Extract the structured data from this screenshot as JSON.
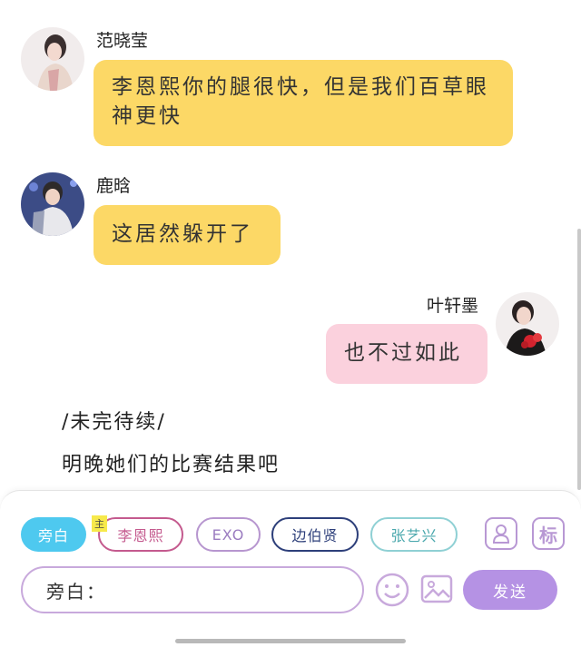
{
  "messages": [
    {
      "sender": "范晓莹",
      "text": "李恩熙你的腿很快，但是我们百草眼神更快",
      "color": "#fcd866"
    },
    {
      "sender": "鹿晗",
      "text": "这居然躲开了",
      "color": "#fcd866"
    },
    {
      "sender": "叶轩墨",
      "text": "也不过如此",
      "color": "#fbd1dd"
    }
  ],
  "narration": [
    "/未完待续/",
    "明晚她们的比赛结果吧"
  ],
  "characters": {
    "narrator": "旁白",
    "main_tag": "主",
    "items": [
      "李恩熙",
      "EXO",
      "边伯贤",
      "张艺兴"
    ]
  },
  "tools": {
    "tag_label": "标",
    "person_icon": "person-card-icon",
    "emoji_icon": "smiley-icon",
    "image_icon": "image-icon"
  },
  "composer": {
    "prefix": "旁白：",
    "send_label": "发送"
  },
  "colors": {
    "accent": "#b592e4",
    "narrator_chip": "#4ec9ef",
    "yellow_bubble": "#fcd866",
    "pink_bubble": "#fbd1dd"
  }
}
